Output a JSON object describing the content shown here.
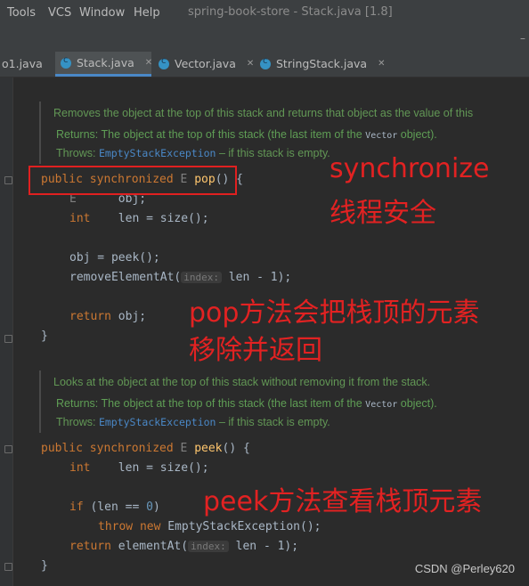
{
  "menu": [
    "Tools",
    "VCS",
    "Window",
    "Help"
  ],
  "window_title": "spring-book-store - Stack.java [1.8]",
  "collapse_glyph": "–",
  "tabs": [
    {
      "label": "o1.java",
      "active": false
    },
    {
      "label": "Stack.java",
      "active": true
    },
    {
      "label": "Vector.java",
      "active": false
    },
    {
      "label": "StringStack.java",
      "active": false
    }
  ],
  "doc1": {
    "line1": "Removes the object at the top of this stack and returns that object as the value of this",
    "returns_prefix": "Returns: The object at the top of this stack (the last item of the ",
    "returns_mono": "Vector",
    "returns_suffix": " object).",
    "throws_label": "Throws: ",
    "throws_exc": "EmptyStackException",
    "throws_suffix": " – if this stack is empty."
  },
  "pop_method": {
    "l1_kw": "public synchronized",
    "l1_gen": "E",
    "l1_name": "pop",
    "l1_rest": "() {",
    "l2_type": "E",
    "l2_rest": "obj;",
    "l3_type": "int",
    "l3_rest": "len = size();",
    "l4": "obj = peek();",
    "l5_a": "removeElementAt(",
    "l5_hint": "index:",
    "l5_b": " len - 1);",
    "l6_kw": "return",
    "l6_rest": " obj;",
    "close": "}"
  },
  "doc2": {
    "line1": "Looks at the object at the top of this stack without removing it from the stack.",
    "returns_prefix": "Returns: The object at the top of this stack (the last item of the ",
    "returns_mono": "Vector",
    "returns_suffix": " object).",
    "throws_label": "Throws: ",
    "throws_exc": "EmptyStackException",
    "throws_suffix": " – if this stack is empty."
  },
  "peek_method": {
    "l1_kw": "public synchronized",
    "l1_gen": "E",
    "l1_name": "peek",
    "l1_rest": "() {",
    "l2_type": "int",
    "l2_rest": "len = size();",
    "l3_kw": "if",
    "l3_a": " (len == ",
    "l3_num": "0",
    "l3_b": ")",
    "l4_kw": "throw new",
    "l4_rest": " EmptyStackException();",
    "l5_kw": "return",
    "l5_a": " elementAt(",
    "l5_hint": "index:",
    "l5_b": " len - 1);",
    "close": "}"
  },
  "annotations": {
    "a1_line1": "synchronize",
    "a1_line2": "线程安全",
    "a2_line1": "pop方法会把栈顶的元素",
    "a2_line2": "移除并返回",
    "a3": "peek方法查看栈顶元素"
  },
  "watermark": "CSDN @Perley620",
  "colors": {
    "keyword": "#cc7832",
    "function": "#ffc66d",
    "doc_comment": "#629755",
    "annotation_red": "#e22222",
    "tab_accent": "#4a88c7"
  }
}
